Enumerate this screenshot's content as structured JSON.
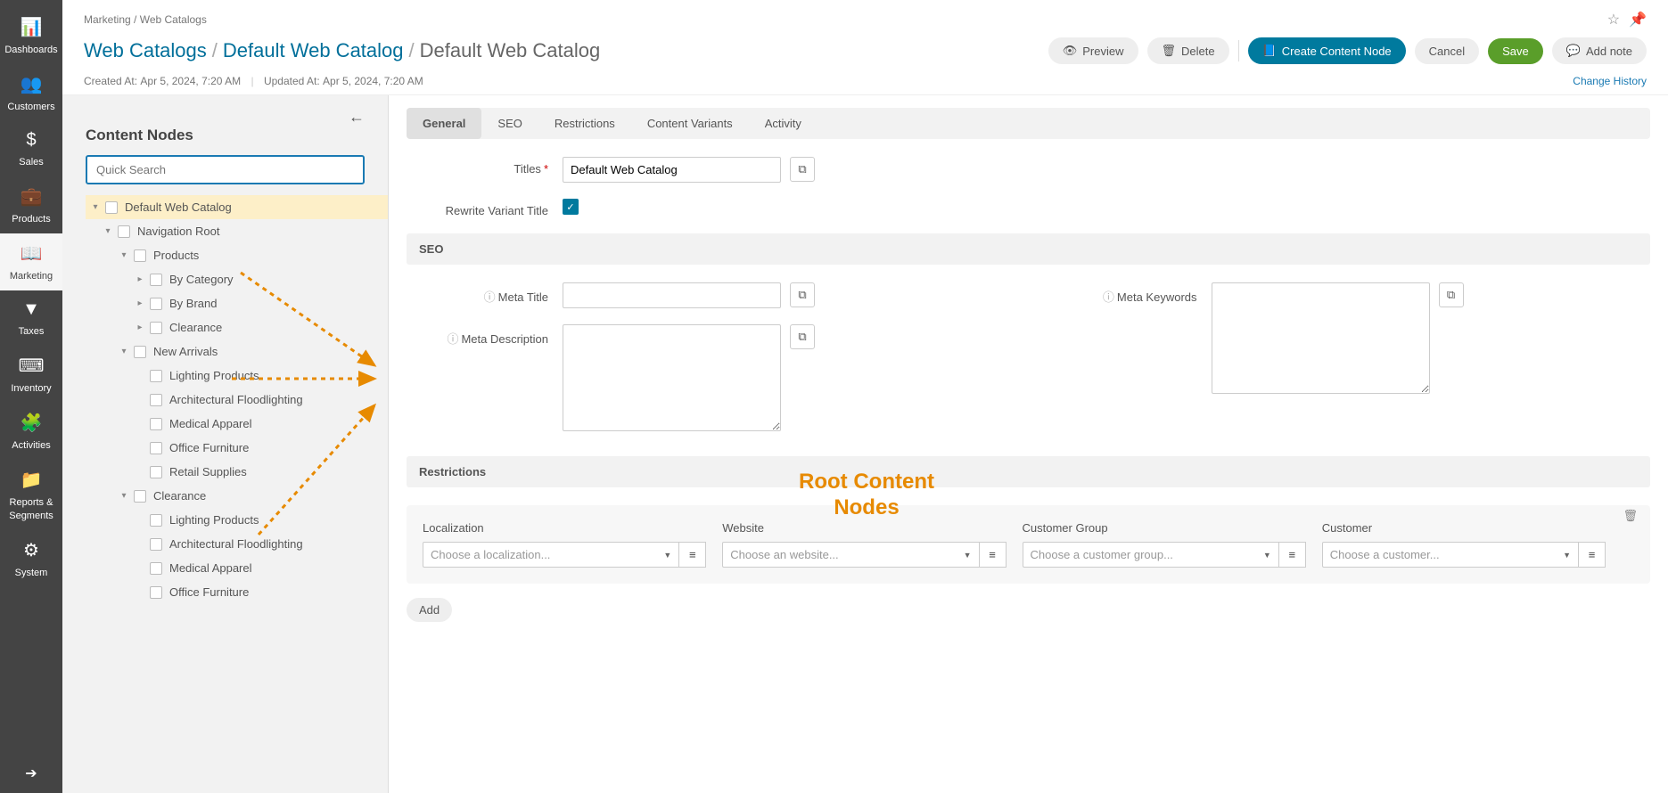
{
  "sidenav": [
    {
      "id": "dashboards",
      "label": "Dashboards",
      "icon": "📊"
    },
    {
      "id": "customers",
      "label": "Customers",
      "icon": "👥"
    },
    {
      "id": "sales",
      "label": "Sales",
      "icon": "$"
    },
    {
      "id": "products",
      "label": "Products",
      "icon": "💼"
    },
    {
      "id": "marketing",
      "label": "Marketing",
      "icon": "📖",
      "active": true
    },
    {
      "id": "taxes",
      "label": "Taxes",
      "icon": "▼"
    },
    {
      "id": "inventory",
      "label": "Inventory",
      "icon": "⌨"
    },
    {
      "id": "activities",
      "label": "Activities",
      "icon": "🧩"
    },
    {
      "id": "reports",
      "label": "Reports & Segments",
      "icon": "📁"
    },
    {
      "id": "system",
      "label": "System",
      "icon": "⚙"
    }
  ],
  "crumbs_small": {
    "a": "Marketing",
    "b": "Web Catalogs"
  },
  "title_crumbs": {
    "a": "Web Catalogs",
    "b": "Default Web Catalog",
    "current": "Default Web Catalog"
  },
  "meta": {
    "created_label": "Created At:",
    "created_val": "Apr 5, 2024, 7:20 AM",
    "updated_label": "Updated At:",
    "updated_val": "Apr 5, 2024, 7:20 AM",
    "change_history": "Change History"
  },
  "actions": {
    "preview": "Preview",
    "delete": "Delete",
    "create": "Create Content Node",
    "cancel": "Cancel",
    "save": "Save",
    "addnote": "Add note"
  },
  "tree": {
    "heading": "Content Nodes",
    "search_placeholder": "Quick Search",
    "nodes": [
      {
        "label": "Default Web Catalog",
        "level": 0,
        "caret": "down",
        "active": true
      },
      {
        "label": "Navigation Root",
        "level": 1,
        "caret": "down"
      },
      {
        "label": "Products",
        "level": 2,
        "caret": "down"
      },
      {
        "label": "By Category",
        "level": 3,
        "caret": "right"
      },
      {
        "label": "By Brand",
        "level": 3,
        "caret": "right"
      },
      {
        "label": "Clearance",
        "level": 3,
        "caret": "right"
      },
      {
        "label": "New Arrivals",
        "level": 2,
        "caret": "down"
      },
      {
        "label": "Lighting Products",
        "level": 3,
        "caret": "none"
      },
      {
        "label": "Architectural Floodlighting",
        "level": 3,
        "caret": "none"
      },
      {
        "label": "Medical Apparel",
        "level": 3,
        "caret": "none"
      },
      {
        "label": "Office Furniture",
        "level": 3,
        "caret": "none"
      },
      {
        "label": "Retail Supplies",
        "level": 3,
        "caret": "none"
      },
      {
        "label": "Clearance",
        "level": 2,
        "caret": "down"
      },
      {
        "label": "Lighting Products",
        "level": 3,
        "caret": "none"
      },
      {
        "label": "Architectural Floodlighting",
        "level": 3,
        "caret": "none"
      },
      {
        "label": "Medical Apparel",
        "level": 3,
        "caret": "none"
      },
      {
        "label": "Office Furniture",
        "level": 3,
        "caret": "none"
      }
    ]
  },
  "tabs": [
    {
      "label": "General",
      "active": true
    },
    {
      "label": "SEO"
    },
    {
      "label": "Restrictions"
    },
    {
      "label": "Content Variants"
    },
    {
      "label": "Activity"
    }
  ],
  "form": {
    "titles_label": "Titles",
    "titles_value": "Default Web Catalog",
    "rewrite_label": "Rewrite Variant Title",
    "seo_heading": "SEO",
    "meta_title_label": "Meta Title",
    "meta_desc_label": "Meta Description",
    "meta_keywords_label": "Meta Keywords",
    "restrictions_heading": "Restrictions",
    "localization": "Localization",
    "localization_ph": "Choose a localization...",
    "website": "Website",
    "website_ph": "Choose an website...",
    "cgroup": "Customer Group",
    "cgroup_ph": "Choose a customer group...",
    "customer": "Customer",
    "customer_ph": "Choose a customer...",
    "add": "Add"
  },
  "annotation": {
    "text_line1": "Root Content",
    "text_line2": "Nodes"
  }
}
